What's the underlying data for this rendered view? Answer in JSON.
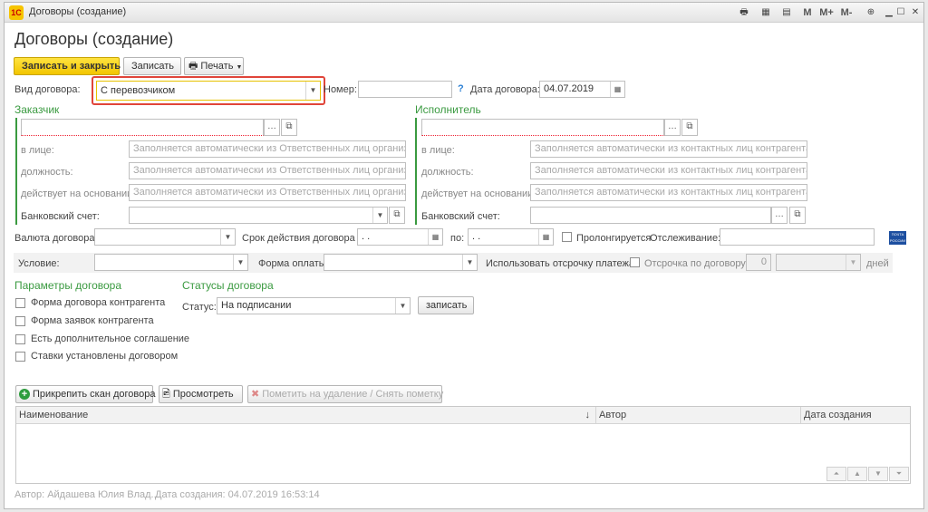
{
  "window": {
    "title": "Договоры (создание)",
    "logo_text": "1С",
    "toolbar_m": "M",
    "toolbar_mplus": "M+",
    "toolbar_mminus": "M-"
  },
  "page_title": "Договоры (создание)",
  "toolbar": {
    "save_close": "Записать и закрыть",
    "save": "Записать",
    "print": "Печать"
  },
  "header": {
    "contract_type_label": "Вид договора:",
    "contract_type_value": "С перевозчиком",
    "number_label": "Номер:",
    "number_value": "",
    "help": "?",
    "date_label": "Дата договора:",
    "date_value": "04.07.2019"
  },
  "customer": {
    "title": "Заказчик",
    "name_value": "",
    "person_label": "в лице:",
    "person_ph": "Заполняется автоматически из Ответственных лиц организац...",
    "position_label": "должность:",
    "position_ph": "Заполняется автоматически из Ответственных лиц организации",
    "basis_label": "действует на основании:",
    "basis_ph": "Заполняется автоматически из Ответственных лиц организац...",
    "bank_label": "Банковский счет:",
    "bank_value": ""
  },
  "executor": {
    "title": "Исполнитель",
    "name_value": "",
    "person_label": "в лице:",
    "person_ph": "Заполняется автоматически из контактных лиц контрагента",
    "position_label": "должность:",
    "position_ph": "Заполняется автоматически из контактных лиц контрагента",
    "basis_label": "действует на основании:",
    "basis_ph": "Заполняется автоматически из контактных лиц контрагента",
    "bank_label": "Банковский счет:",
    "bank_value": ""
  },
  "terms": {
    "currency_label": "Валюта договора:",
    "currency_value": "",
    "validity_label": "Срок действия договора с:",
    "validity_from": " .  .",
    "to_label": "по:",
    "validity_to": " .  .",
    "prolong_label": "Пролонгируется",
    "tracking_label": "Отслеживание:",
    "tracking_value": "",
    "pochta_text": "ПОЧТА РОССИИ",
    "condition_label": "Условие:",
    "condition_value": "",
    "payment_label": "Форма оплаты:",
    "payment_value": "",
    "deferral_label": "Использовать отсрочку платежа:",
    "deferral_contract_label": "Отсрочка по договору:",
    "deferral_days_value": "0",
    "deferral_unit_value": "",
    "days_label": "дней"
  },
  "params": {
    "title": "Параметры договора",
    "items": [
      "Форма договора контрагента",
      "Форма заявок контрагента",
      "Есть дополнительное соглашение",
      "Ставки установлены договором"
    ]
  },
  "statuses": {
    "title": "Статусы договора",
    "status_label": "Статус:",
    "status_value": "На подписании",
    "save_button": "записать"
  },
  "files": {
    "attach": "Прикрепить скан договора",
    "view": "Просмотреть",
    "mark_delete": "Пометить на удаление / Снять пометку",
    "col_name": "Наименование",
    "sort_indicator": "↓",
    "col_author": "Автор",
    "col_created": "Дата создания"
  },
  "footer": {
    "author": "Автор:  Айдашева Юлия Влад...",
    "created": "Дата создания:  04.07.2019 16:53:14"
  }
}
